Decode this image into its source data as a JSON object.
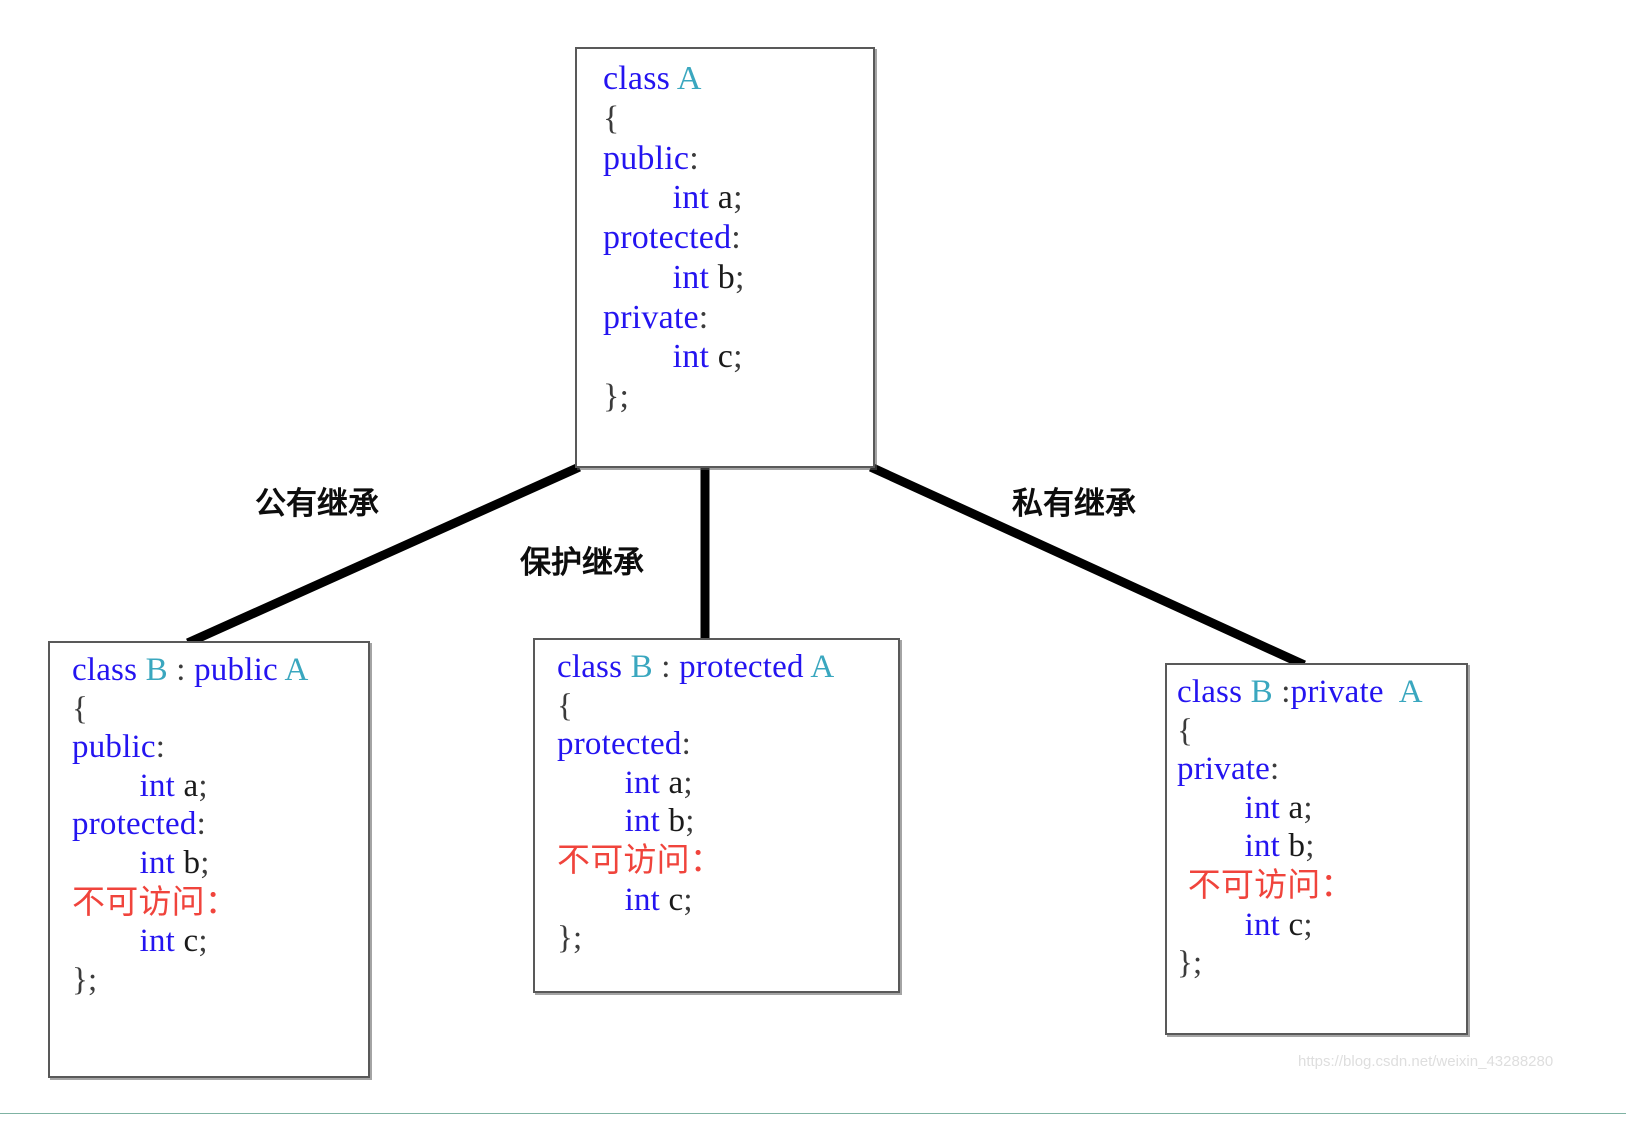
{
  "diagram": {
    "title": "C++ inheritance access specifier diagram",
    "colors": {
      "keyword": "#2414f0",
      "type_name": "#3aa7bf",
      "identifier": "#1a1a1a",
      "punctuation": "#3b3b3b",
      "inaccessible": "#f0443c",
      "edge": "#000000",
      "box_border": "#595959",
      "background": "#ffffff"
    }
  },
  "base_class": {
    "name": "box-a",
    "lines": [
      {
        "parts": [
          {
            "t": "class ",
            "c": "kw"
          },
          {
            "t": "A",
            "c": "typ"
          }
        ]
      },
      {
        "parts": [
          {
            "t": "{",
            "c": "pun"
          }
        ]
      },
      {
        "parts": [
          {
            "t": "public",
            "c": "kw"
          },
          {
            "t": ":",
            "c": "pun"
          }
        ]
      },
      {
        "parts": [
          {
            "t": "        int ",
            "c": "kw"
          },
          {
            "t": "a",
            "c": "id"
          },
          {
            "t": ";",
            "c": "pun"
          }
        ]
      },
      {
        "parts": [
          {
            "t": "protected",
            "c": "kw"
          },
          {
            "t": ":",
            "c": "pun"
          }
        ]
      },
      {
        "parts": [
          {
            "t": "        int ",
            "c": "kw"
          },
          {
            "t": "b",
            "c": "id"
          },
          {
            "t": ";",
            "c": "pun"
          }
        ]
      },
      {
        "parts": [
          {
            "t": "private",
            "c": "kw"
          },
          {
            "t": ":",
            "c": "pun"
          }
        ]
      },
      {
        "parts": [
          {
            "t": "        int ",
            "c": "kw"
          },
          {
            "t": "c",
            "c": "id"
          },
          {
            "t": ";",
            "c": "pun"
          }
        ]
      },
      {
        "parts": [
          {
            "t": "};",
            "c": "pun"
          }
        ]
      }
    ]
  },
  "derived_public": {
    "name": "box-b-public",
    "lines": [
      {
        "parts": [
          {
            "t": "class ",
            "c": "kw"
          },
          {
            "t": "B",
            "c": "typ"
          },
          {
            "t": " : ",
            "c": "pun"
          },
          {
            "t": "public ",
            "c": "kw"
          },
          {
            "t": "A",
            "c": "typ"
          }
        ]
      },
      {
        "parts": [
          {
            "t": "{",
            "c": "pun"
          }
        ]
      },
      {
        "parts": [
          {
            "t": "public",
            "c": "kw"
          },
          {
            "t": ":",
            "c": "pun"
          }
        ]
      },
      {
        "parts": [
          {
            "t": "        int ",
            "c": "kw"
          },
          {
            "t": "a",
            "c": "id"
          },
          {
            "t": ";",
            "c": "pun"
          }
        ]
      },
      {
        "parts": [
          {
            "t": "protected",
            "c": "kw"
          },
          {
            "t": ":",
            "c": "pun"
          }
        ]
      },
      {
        "parts": [
          {
            "t": "        int ",
            "c": "kw"
          },
          {
            "t": "b",
            "c": "id"
          },
          {
            "t": ";",
            "c": "pun"
          }
        ]
      },
      {
        "parts": [
          {
            "t": "不可访问",
            "c": "bad cjk"
          },
          {
            "t": "：",
            "c": "bad cjk"
          }
        ]
      },
      {
        "parts": [
          {
            "t": "        int ",
            "c": "kw"
          },
          {
            "t": "c",
            "c": "id"
          },
          {
            "t": ";",
            "c": "pun"
          }
        ]
      },
      {
        "parts": [
          {
            "t": "};",
            "c": "pun"
          }
        ]
      }
    ]
  },
  "derived_protected": {
    "name": "box-b-protected",
    "lines": [
      {
        "parts": [
          {
            "t": "class ",
            "c": "kw"
          },
          {
            "t": "B",
            "c": "typ"
          },
          {
            "t": " : ",
            "c": "pun"
          },
          {
            "t": "protected ",
            "c": "kw"
          },
          {
            "t": "A",
            "c": "typ"
          }
        ]
      },
      {
        "parts": [
          {
            "t": "{",
            "c": "pun"
          }
        ]
      },
      {
        "parts": [
          {
            "t": "protected",
            "c": "kw"
          },
          {
            "t": ":",
            "c": "pun"
          }
        ]
      },
      {
        "parts": [
          {
            "t": "        int ",
            "c": "kw"
          },
          {
            "t": "a",
            "c": "id"
          },
          {
            "t": ";",
            "c": "pun"
          }
        ]
      },
      {
        "parts": [
          {
            "t": "        int ",
            "c": "kw"
          },
          {
            "t": "b",
            "c": "id"
          },
          {
            "t": ";",
            "c": "pun"
          }
        ]
      },
      {
        "parts": [
          {
            "t": "不可访问",
            "c": "bad cjk"
          },
          {
            "t": "：",
            "c": "bad cjk"
          }
        ]
      },
      {
        "parts": [
          {
            "t": "        int ",
            "c": "kw"
          },
          {
            "t": "c",
            "c": "id"
          },
          {
            "t": ";",
            "c": "pun"
          }
        ]
      },
      {
        "parts": [
          {
            "t": "};",
            "c": "pun"
          }
        ]
      }
    ]
  },
  "derived_private": {
    "name": "box-b-private",
    "lines": [
      {
        "parts": [
          {
            "t": "class ",
            "c": "kw"
          },
          {
            "t": "B",
            "c": "typ"
          },
          {
            "t": " :",
            "c": "pun"
          },
          {
            "t": "private ",
            "c": "kw"
          },
          {
            "t": " A",
            "c": "typ"
          }
        ]
      },
      {
        "parts": [
          {
            "t": "{",
            "c": "pun"
          }
        ]
      },
      {
        "parts": [
          {
            "t": "private",
            "c": "kw"
          },
          {
            "t": ":",
            "c": "pun"
          }
        ]
      },
      {
        "parts": [
          {
            "t": "        int ",
            "c": "kw"
          },
          {
            "t": "a",
            "c": "id"
          },
          {
            "t": ";",
            "c": "pun"
          }
        ]
      },
      {
        "parts": [
          {
            "t": "        int ",
            "c": "kw"
          },
          {
            "t": "b",
            "c": "id"
          },
          {
            "t": ";",
            "c": "pun"
          }
        ]
      },
      {
        "parts": [
          {
            "t": " 不可访问",
            "c": "bad cjk"
          },
          {
            "t": "：",
            "c": "bad cjk"
          }
        ]
      },
      {
        "parts": [
          {
            "t": "        int ",
            "c": "kw"
          },
          {
            "t": "c",
            "c": "id"
          },
          {
            "t": ";",
            "c": "pun"
          }
        ]
      },
      {
        "parts": [
          {
            "t": "};",
            "c": "pun"
          }
        ]
      }
    ]
  },
  "edge_labels": {
    "public_inheritance": "公有继承",
    "protected_inheritance": "保护继承",
    "private_inheritance": "私有继承"
  },
  "watermark": {
    "text": "https://blog.csdn.net/weixin_43288280"
  }
}
